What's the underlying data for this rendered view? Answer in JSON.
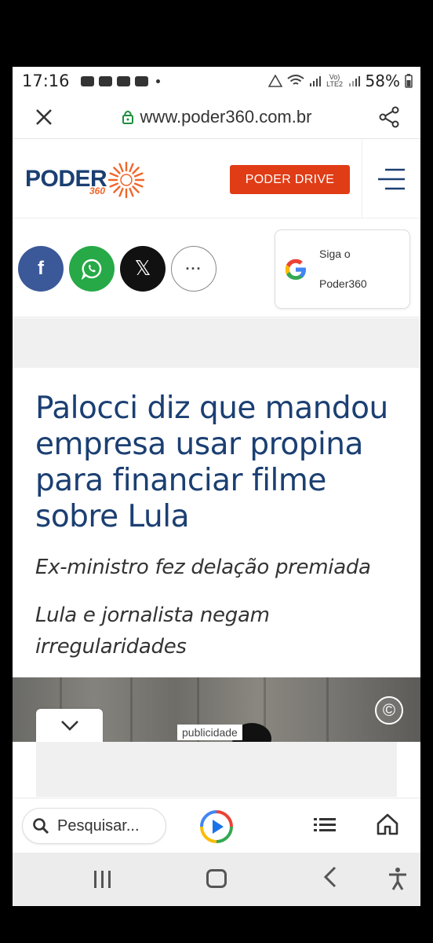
{
  "status_bar": {
    "time": "17:16",
    "network": "Vo) LTE2",
    "battery": "58%"
  },
  "url_bar": {
    "url": "www.poder360.com.br"
  },
  "site_header": {
    "logo_word": "PODER",
    "logo_number": "360",
    "drive_button": "PODER DRIVE"
  },
  "share": {
    "facebook": "f",
    "x": "𝕏",
    "more": "···",
    "google_follow_line1": "Siga o",
    "google_follow_line2": "Poder360"
  },
  "article": {
    "headline": "Palocci diz que mandou empresa usar propina para financiar filme sobre Lula",
    "subtitle_1": "Ex-ministro fez delação premiada",
    "subtitle_2": "Lula e jornalista negam irregularidades"
  },
  "ad": {
    "label": "publicidade"
  },
  "toolbar": {
    "search_label": "Pesquisar..."
  },
  "colors": {
    "brand_blue": "#1b3f72",
    "brand_orange": "#f0662a",
    "drive_red": "#e03c16",
    "facebook": "#3b5998",
    "whatsapp": "#26a946"
  }
}
